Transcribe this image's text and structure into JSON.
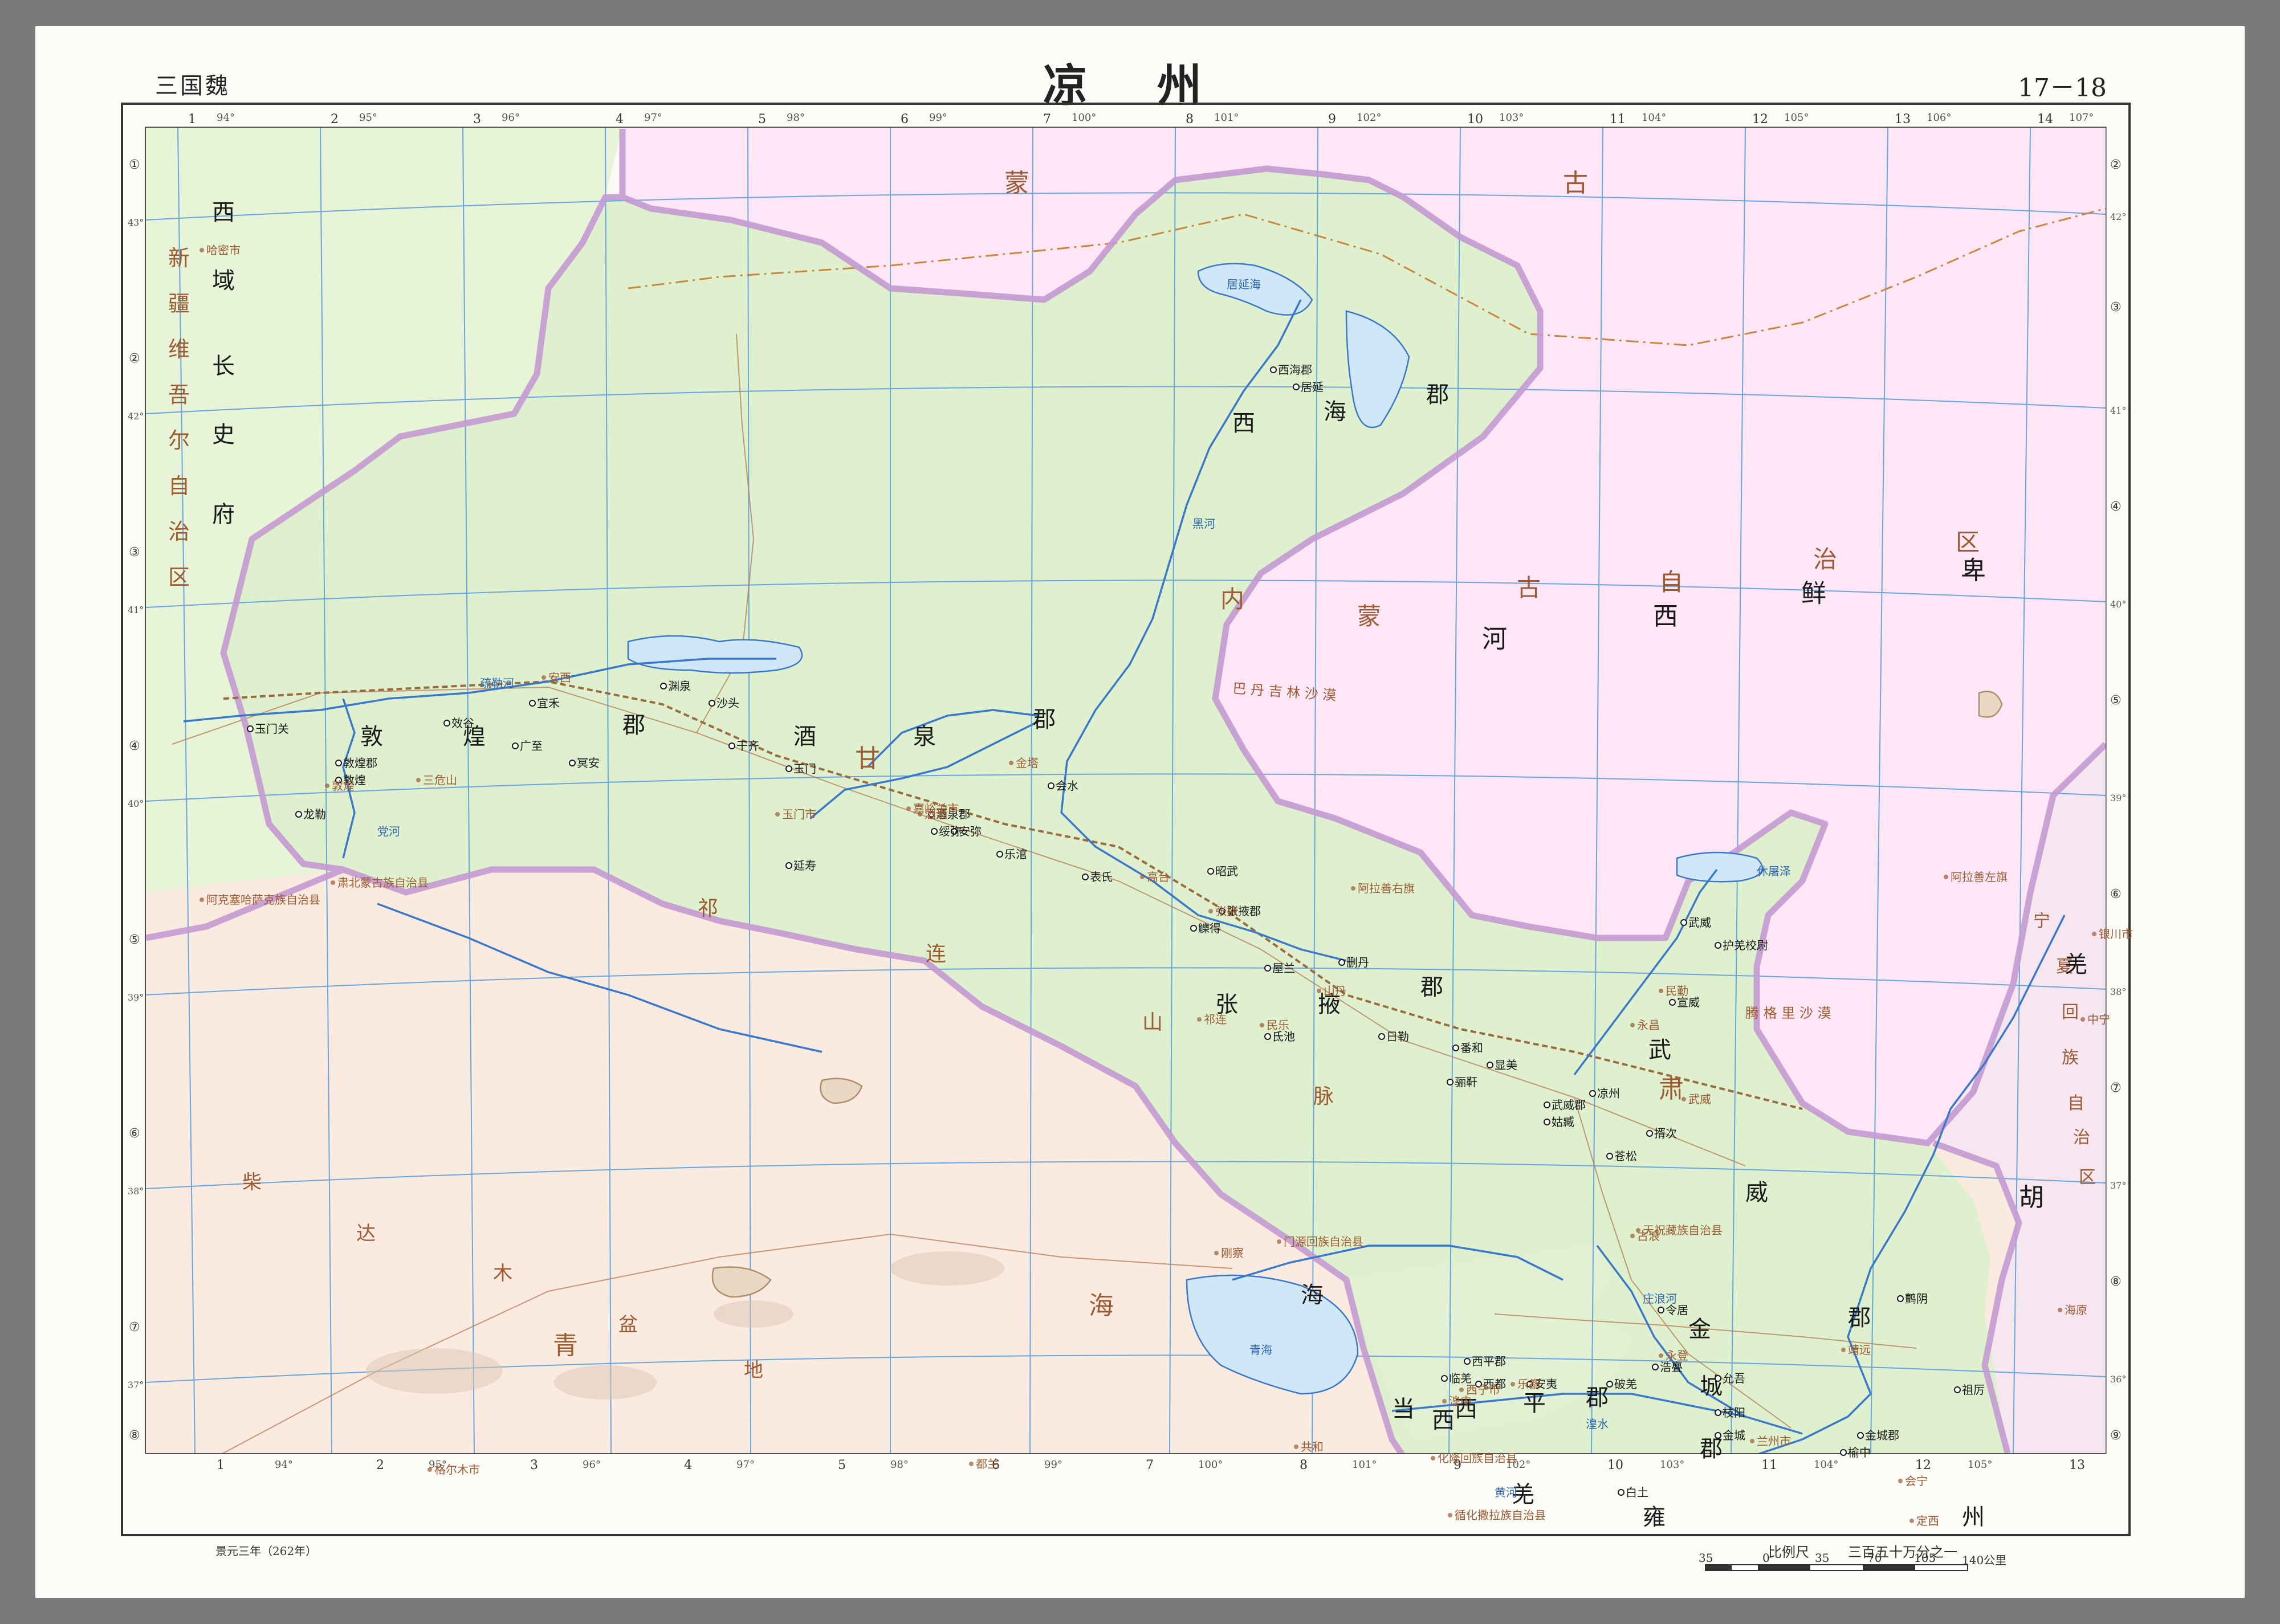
{
  "header": {
    "dynasty": "三国魏",
    "title_chars": [
      "凉",
      "州"
    ],
    "page_numbers": "17－18"
  },
  "frame": {
    "top_index": [
      "1",
      "2",
      "3",
      "4",
      "5",
      "6",
      "7",
      "8",
      "9",
      "10",
      "11",
      "12",
      "13",
      "14"
    ],
    "top_longitudes": [
      "94°",
      "95°",
      "96°",
      "97°",
      "98°",
      "99°",
      "100°",
      "101°",
      "102°",
      "103°",
      "104°",
      "105°",
      "106°",
      "107°"
    ],
    "bottom_index": [
      "1",
      "2",
      "3",
      "4",
      "5",
      "6",
      "7",
      "8",
      "9",
      "10",
      "11",
      "12",
      "13"
    ],
    "bottom_longitudes": [
      "94°",
      "95°",
      "96°",
      "97°",
      "98°",
      "99°",
      "100°",
      "101°",
      "102°",
      "103°",
      "104°",
      "105°"
    ],
    "left_index": [
      "①",
      "②",
      "③",
      "④",
      "⑤",
      "⑥",
      "⑦",
      "⑧"
    ],
    "right_index": [
      "②",
      "③",
      "④",
      "⑤",
      "⑥",
      "⑦",
      "⑧",
      "⑨"
    ],
    "left_latitudes": [
      "43°",
      "42°",
      "41°",
      "40°",
      "39°",
      "38°",
      "37°"
    ],
    "right_latitudes": [
      "42°",
      "41°",
      "40°",
      "39°",
      "38°",
      "37°",
      "36°"
    ]
  },
  "colors": {
    "liangzhou_fill": "#dff0cf",
    "west_region_fill": "#e7f4d7",
    "inner_mongolia_fill": "#fde7f7",
    "qinghai_fill": "#fbeadf",
    "province_border": "#c49ad2",
    "rivers": "#3a78c9",
    "lakes": "#cfe7f6",
    "grid": "#6aa6dd",
    "historical_labels": "#1a1a1a",
    "modern_labels": "#9c5b33"
  },
  "region_labels": {
    "xiyu": [
      "西",
      "域",
      "长",
      "史",
      "府"
    ],
    "xinjiang": [
      "新",
      "疆",
      "维",
      "吾",
      "尔",
      "自",
      "治",
      "区"
    ],
    "menggu_top": [
      "蒙",
      "古"
    ],
    "neimenggu": [
      "内",
      "蒙",
      "古",
      "自",
      "治",
      "区"
    ],
    "hexi_xianbei": [
      "河",
      "西",
      "鲜",
      "卑"
    ],
    "gansu": [
      "甘",
      "肃"
    ],
    "qilian": [
      "祁",
      "连",
      "山",
      "脉"
    ],
    "qinghai_hu_label": [
      "海"
    ],
    "qinghai_province": [
      "青",
      "海"
    ],
    "chaidamu": [
      "柴",
      "达",
      "木",
      "盆",
      "地"
    ],
    "ningxia": [
      "宁",
      "夏",
      "回",
      "族",
      "自",
      "治",
      "区"
    ],
    "hu": [
      "胡"
    ],
    "xikiang": [
      "羌"
    ],
    "yongzhou": [
      "雍",
      "州"
    ],
    "dunhuang_jun": [
      "敦",
      "煌",
      "郡"
    ],
    "jiuquan_jun": [
      "酒",
      "泉",
      "郡"
    ],
    "xihai_jun": [
      "西",
      "海",
      "郡"
    ],
    "zhangye_jun": [
      "张",
      "掖",
      "郡"
    ],
    "wuwei_jun": [
      "武",
      "威",
      "郡"
    ],
    "xiping_jun": [
      "西",
      "平",
      "郡"
    ],
    "jincheng_jun": [
      "金",
      "城",
      "郡"
    ],
    "dang_xi_qiang": [
      "当",
      "西",
      "羌"
    ]
  },
  "deserts": {
    "badain_jaran": "巴 丹 吉 林 沙 漠",
    "tengger": "腾 格 里 沙 漠"
  },
  "historical_places": [
    {
      "label": "敦煌郡",
      "anchor": "start"
    },
    {
      "label": "敦煌",
      "anchor": "start"
    },
    {
      "label": "龙勒",
      "anchor": "start"
    },
    {
      "label": "玉门关",
      "anchor": "start"
    },
    {
      "label": "效谷",
      "anchor": "start"
    },
    {
      "label": "广至",
      "anchor": "start"
    },
    {
      "label": "宜禾",
      "anchor": "start"
    },
    {
      "label": "冥安",
      "anchor": "start"
    },
    {
      "label": "渊泉",
      "anchor": "start"
    },
    {
      "label": "沙头",
      "anchor": "start"
    },
    {
      "label": "干齐",
      "anchor": "start"
    },
    {
      "label": "玉门",
      "anchor": "start"
    },
    {
      "label": "延寿",
      "anchor": "start"
    },
    {
      "label": "酒泉郡",
      "anchor": "start"
    },
    {
      "label": "绥弥",
      "anchor": "start"
    },
    {
      "label": "安弥",
      "anchor": "start"
    },
    {
      "label": "会水",
      "anchor": "start"
    },
    {
      "label": "乐涫",
      "anchor": "start"
    },
    {
      "label": "表氏",
      "anchor": "start"
    },
    {
      "label": "昭武",
      "anchor": "start"
    },
    {
      "label": "张掖郡",
      "anchor": "start"
    },
    {
      "label": "觻得",
      "anchor": "start"
    },
    {
      "label": "屋兰",
      "anchor": "start"
    },
    {
      "label": "删丹",
      "anchor": "start"
    },
    {
      "label": "氐池",
      "anchor": "start"
    },
    {
      "label": "日勒",
      "anchor": "start"
    },
    {
      "label": "西海郡",
      "anchor": "start"
    },
    {
      "label": "居延",
      "anchor": "start"
    },
    {
      "label": "武威",
      "anchor": "start"
    },
    {
      "label": "护羌校尉",
      "anchor": "start"
    },
    {
      "label": "宣威",
      "anchor": "start"
    },
    {
      "label": "番和",
      "anchor": "start"
    },
    {
      "label": "骊靬",
      "anchor": "start"
    },
    {
      "label": "显美",
      "anchor": "start"
    },
    {
      "label": "凉州",
      "anchor": "start"
    },
    {
      "label": "武威郡",
      "anchor": "start"
    },
    {
      "label": "姑臧",
      "anchor": "start"
    },
    {
      "label": "揟次",
      "anchor": "start"
    },
    {
      "label": "苍松",
      "anchor": "start"
    },
    {
      "label": "西平郡",
      "anchor": "start"
    },
    {
      "label": "临羌",
      "anchor": "start"
    },
    {
      "label": "西都",
      "anchor": "start"
    },
    {
      "label": "安夷",
      "anchor": "start"
    },
    {
      "label": "破羌",
      "anchor": "start"
    },
    {
      "label": "令居",
      "anchor": "start"
    },
    {
      "label": "浩亹",
      "anchor": "start"
    },
    {
      "label": "允吾",
      "anchor": "start"
    },
    {
      "label": "枝阳",
      "anchor": "start"
    },
    {
      "label": "金城",
      "anchor": "start"
    },
    {
      "label": "金城郡",
      "anchor": "start"
    },
    {
      "label": "榆中",
      "anchor": "start"
    },
    {
      "label": "鹯阴",
      "anchor": "start"
    },
    {
      "label": "祖厉",
      "anchor": "start"
    },
    {
      "label": "白土",
      "anchor": "start"
    }
  ],
  "modern_places": [
    {
      "label": "哈密市"
    },
    {
      "label": "敦煌"
    },
    {
      "label": "安西"
    },
    {
      "label": "玉门市"
    },
    {
      "label": "嘉峪关市"
    },
    {
      "label": "酒泉"
    },
    {
      "label": "金塔"
    },
    {
      "label": "高台"
    },
    {
      "label": "张掖"
    },
    {
      "label": "民乐"
    },
    {
      "label": "山丹"
    },
    {
      "label": "民勤"
    },
    {
      "label": "永昌"
    },
    {
      "label": "武威"
    },
    {
      "label": "古浪"
    },
    {
      "label": "西宁市"
    },
    {
      "label": "乐都"
    },
    {
      "label": "湟中"
    },
    {
      "label": "永登"
    },
    {
      "label": "兰州市"
    },
    {
      "label": "靖远"
    },
    {
      "label": "会宁"
    },
    {
      "label": "海原"
    },
    {
      "label": "定西"
    },
    {
      "label": "银川市"
    },
    {
      "label": "中宁"
    },
    {
      "label": "格尔木市"
    },
    {
      "label": "共和"
    },
    {
      "label": "都兰"
    },
    {
      "label": "阿拉善右旗"
    },
    {
      "label": "阿拉善左旗"
    },
    {
      "label": "肃北蒙古族自治县"
    },
    {
      "label": "阿克塞哈萨克族自治县"
    },
    {
      "label": "天祝藏族自治县"
    },
    {
      "label": "门源回族自治县"
    },
    {
      "label": "化隆回族自治县"
    },
    {
      "label": "循化撒拉族自治县"
    },
    {
      "label": "三危山"
    },
    {
      "label": "祁连"
    },
    {
      "label": "刚察"
    }
  ],
  "water_labels": [
    "居延海",
    "休屠泽",
    "青海",
    "黑河",
    "黄河",
    "疏勒河",
    "党河",
    "湟水",
    "庄浪河"
  ],
  "footer": {
    "date_note": "景元三年（262年）",
    "scale_title": "比例尺",
    "scale_ratio": "三百五十万分之一",
    "scale_ticks": [
      "35",
      "0",
      "35",
      "70",
      "105",
      "140公里"
    ]
  }
}
